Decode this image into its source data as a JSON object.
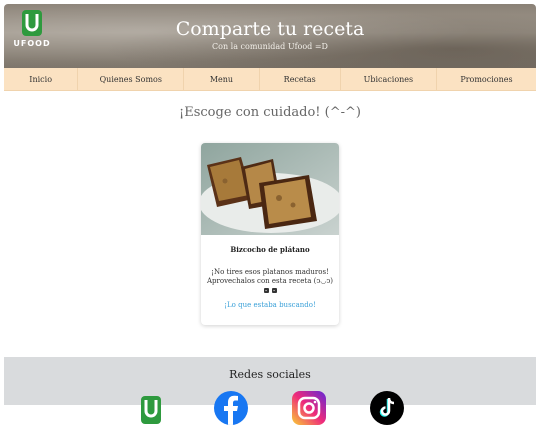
{
  "header": {
    "logo_text": "UFOOD",
    "title": "Comparte tu receta",
    "subtitle": "Con la comunidad Ufood =D"
  },
  "nav": {
    "items": [
      {
        "label": "Inicio"
      },
      {
        "label": "Quienes Somos"
      },
      {
        "label": "Menu"
      },
      {
        "label": "Recetas"
      },
      {
        "label": "Ubicaciones"
      },
      {
        "label": "Promociones"
      }
    ]
  },
  "main": {
    "tagline": "¡Escoge con cuidado! (^-^)",
    "card": {
      "title": "Bizcocho de plátano",
      "description": "¡No tires esos platanos maduros! Aprovechalos con esta receta (ↄ◡ↄ)",
      "link": "¡Lo que estaba buscando!"
    }
  },
  "footer": {
    "title": "Redes sociales",
    "social": [
      {
        "icon": "ufood-icon"
      },
      {
        "icon": "facebook-icon"
      },
      {
        "icon": "instagram-icon"
      },
      {
        "icon": "tiktok-icon"
      }
    ]
  },
  "colors": {
    "nav_bg": "#fbe2c2",
    "link": "#3aa0d8",
    "footer_bg": "#d9dbdd",
    "brand_green": "#2e9a3e"
  }
}
